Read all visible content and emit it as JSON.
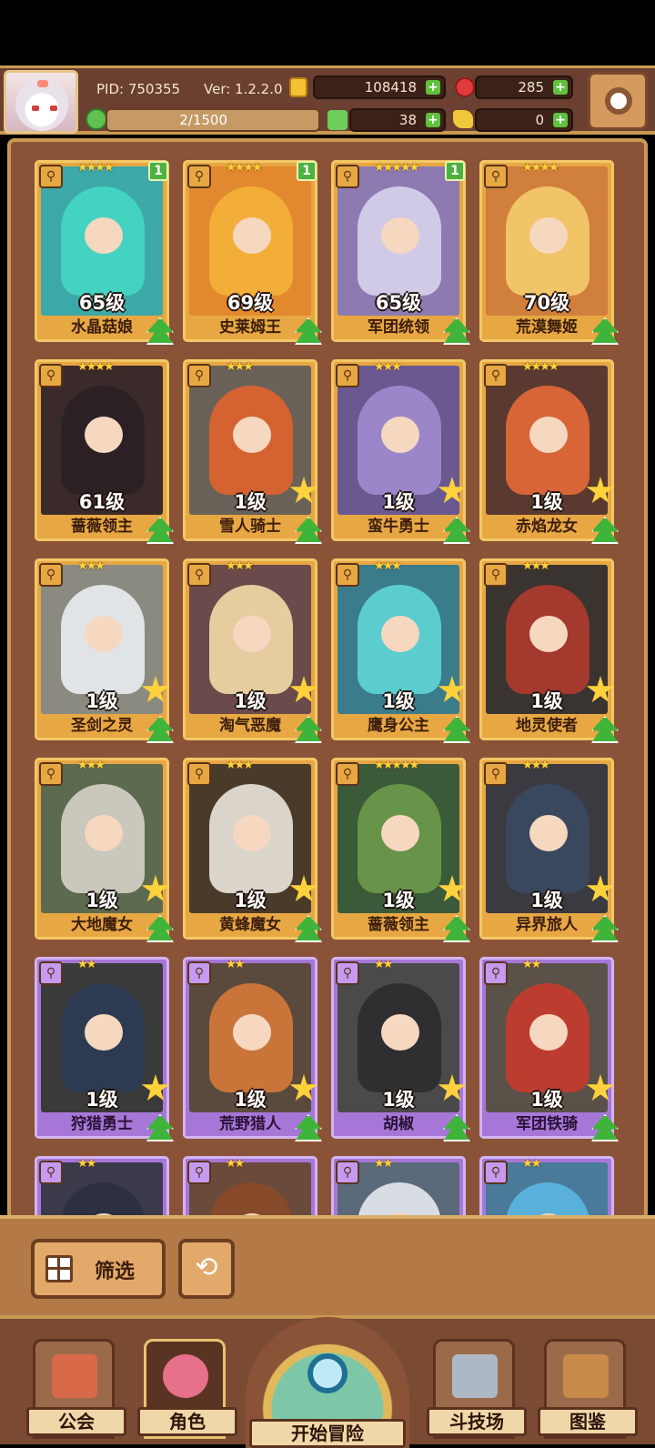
{
  "header": {
    "pid": "PID: 750355",
    "version": "Ver: 1.2.2.0",
    "gold": "108418",
    "apples": "285",
    "stamina": "2/1500",
    "clover": "38",
    "keys": "0"
  },
  "cards": [
    {
      "name": "水晶菇娘",
      "level": "65级",
      "stars": "★★★★",
      "badge": "1",
      "frame": "gold",
      "color": "#3da8a8",
      "hair": "#44d7c2"
    },
    {
      "name": "史莱姆王",
      "level": "69级",
      "stars": "★★★★",
      "badge": "1",
      "frame": "gold",
      "color": "#e2892f",
      "hair": "#f4b23a"
    },
    {
      "name": "军团统领",
      "level": "65级",
      "stars": "★★★★★",
      "badge": "1",
      "frame": "gold",
      "color": "#8d7ab0",
      "hair": "#d8d3ec"
    },
    {
      "name": "荒漠舞姬",
      "level": "70级",
      "stars": "★★★★",
      "badge": "",
      "frame": "gold",
      "color": "#d17f3c",
      "hair": "#f3cc6b"
    },
    {
      "name": "蔷薇领主",
      "level": "61级",
      "stars": "★★★★",
      "badge": "",
      "frame": "gold",
      "color": "#3b2a2a",
      "hair": "#2a2025"
    },
    {
      "name": "雪人骑士",
      "level": "1级",
      "stars": "★★★",
      "badge": "",
      "frame": "gold",
      "color": "#6a6258",
      "hair": "#e0642e"
    },
    {
      "name": "蛮牛勇士",
      "level": "1级",
      "stars": "★★★",
      "badge": "",
      "frame": "gold",
      "color": "#6a5890",
      "hair": "#a08ccf"
    },
    {
      "name": "赤焰龙女",
      "level": "1级",
      "stars": "★★★★",
      "badge": "",
      "frame": "gold",
      "color": "#5a3a30",
      "hair": "#e66a3a"
    },
    {
      "name": "圣剑之灵",
      "level": "1级",
      "stars": "★★★",
      "badge": "",
      "frame": "gold",
      "color": "#8a8a80",
      "hair": "#e9edf2"
    },
    {
      "name": "淘气恶魔",
      "level": "1级",
      "stars": "★★★",
      "badge": "",
      "frame": "gold",
      "color": "#6a4a4a",
      "hair": "#f3dca8"
    },
    {
      "name": "鹰身公主",
      "level": "1级",
      "stars": "★★★",
      "badge": "",
      "frame": "gold",
      "color": "#3a7c8c",
      "hair": "#5fd6d6"
    },
    {
      "name": "地灵使者",
      "level": "1级",
      "stars": "★★★",
      "badge": "",
      "frame": "gold",
      "color": "#3a3430",
      "hair": "#b03a2e"
    },
    {
      "name": "大地魔女",
      "level": "1级",
      "stars": "★★★",
      "badge": "",
      "frame": "gold",
      "color": "#5c6a50",
      "hair": "#d6d2c8"
    },
    {
      "name": "黄蜂魔女",
      "level": "1级",
      "stars": "★★★",
      "badge": "",
      "frame": "gold",
      "color": "#4a3a2a",
      "hair": "#eae5dc"
    },
    {
      "name": "蔷薇领主",
      "level": "1级",
      "stars": "★★★★★",
      "badge": "",
      "frame": "gold",
      "color": "#3a5a3a",
      "hair": "#6d9a4a"
    },
    {
      "name": "异界旅人",
      "level": "1级",
      "stars": "★★★",
      "badge": "",
      "frame": "gold",
      "color": "#3a3a40",
      "hair": "#3a4a60"
    },
    {
      "name": "狩猎勇士",
      "level": "1级",
      "stars": "★★",
      "badge": "",
      "frame": "purple",
      "color": "#3a3a3a",
      "hair": "#2b3c54"
    },
    {
      "name": "荒野猎人",
      "level": "1级",
      "stars": "★★",
      "badge": "",
      "frame": "purple",
      "color": "#5a4a3e",
      "hair": "#d57a3a"
    },
    {
      "name": "胡椒",
      "level": "1级",
      "stars": "★★",
      "badge": "",
      "frame": "purple",
      "color": "#4a4a4a",
      "hair": "#2c2c30"
    },
    {
      "name": "军团铁骑",
      "level": "1级",
      "stars": "★★",
      "badge": "",
      "frame": "purple",
      "color": "#5a5248",
      "hair": "#c83a2e"
    },
    {
      "name": "",
      "level": "",
      "stars": "★★",
      "badge": "",
      "frame": "purple",
      "color": "#3a3a4a",
      "hair": "#2c3040"
    },
    {
      "name": "",
      "level": "",
      "stars": "★★",
      "badge": "",
      "frame": "purple",
      "color": "#6a4a3a",
      "hair": "#8a4a2a"
    },
    {
      "name": "",
      "level": "",
      "stars": "★★",
      "badge": "",
      "frame": "purple",
      "color": "#5a6a7a",
      "hair": "#e6eaee"
    },
    {
      "name": "",
      "level": "",
      "stars": "★★",
      "badge": "",
      "frame": "purple",
      "color": "#4a7a9a",
      "hair": "#5ab6e2"
    }
  ],
  "filter": {
    "label": "筛选",
    "reset_icon": "refresh-icon"
  },
  "nav": {
    "guild": "公会",
    "role": "角色",
    "adventure": "开始冒险",
    "arena": "斗技场",
    "codex": "图鉴"
  }
}
